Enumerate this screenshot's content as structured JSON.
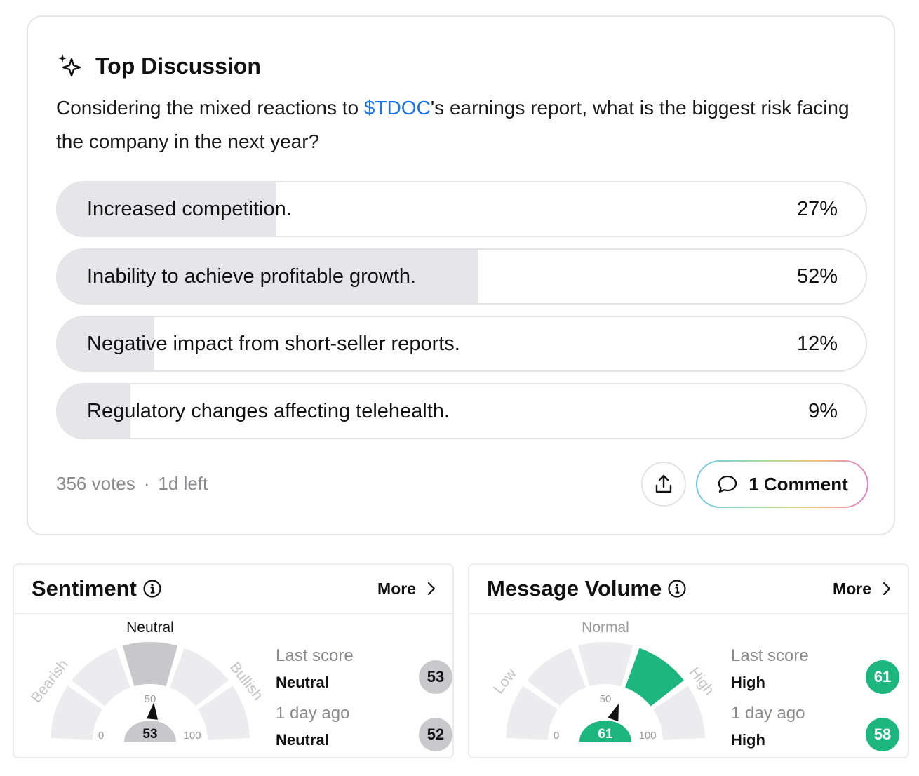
{
  "discussion": {
    "title": "Top Discussion",
    "question_before": "Considering the mixed reactions to ",
    "ticker": "$TDOC",
    "question_after": "'s earnings report, what is the biggest risk facing the company in the next year?",
    "options": [
      {
        "label": "Increased competition.",
        "percent_text": "27%",
        "percent": 27
      },
      {
        "label": "Inability to achieve profitable growth.",
        "percent_text": "52%",
        "percent": 52
      },
      {
        "label": "Negative impact from short-seller reports.",
        "percent_text": "12%",
        "percent": 12
      },
      {
        "label": "Regulatory changes affecting telehealth.",
        "percent_text": "9%",
        "percent": 9
      }
    ],
    "votes": "356 votes",
    "separator": "·",
    "time_left": "1d left",
    "comment_label": "1 Comment",
    "icons": {
      "header": "sparkle-icon",
      "share": "share-icon",
      "comment": "comment-icon"
    }
  },
  "sentiment": {
    "title": "Sentiment",
    "more": "More",
    "gauge": {
      "top_label": "Neutral",
      "left_label": "Bearish",
      "right_label": "Bullish",
      "min_label": "0",
      "mid_label": "50",
      "max_label": "100",
      "value": 53,
      "value_text": "53",
      "active_segment": 2,
      "active_color": "#c8c8cb",
      "needle_color": "#111111"
    },
    "last_score_label": "Last score",
    "last_score_value": "Neutral",
    "last_score_badge": "53",
    "prev_label": "1 day ago",
    "prev_value": "Neutral",
    "prev_badge": "52"
  },
  "volume": {
    "title": "Message Volume",
    "more": "More",
    "gauge": {
      "top_label": "Normal",
      "left_label": "Low",
      "right_label": "High",
      "min_label": "0",
      "mid_label": "50",
      "max_label": "100",
      "value": 61,
      "value_text": "61",
      "active_segment": 3,
      "active_color": "#1db67e",
      "needle_color": "#111111"
    },
    "last_score_label": "Last score",
    "last_score_value": "High",
    "last_score_badge": "61",
    "prev_label": "1 day ago",
    "prev_value": "High",
    "prev_badge": "58"
  },
  "colors": {
    "link": "#1a73e8",
    "bar_fill": "#e6e6ea",
    "high": "#1db67e",
    "neutral": "#c9c9cc"
  }
}
